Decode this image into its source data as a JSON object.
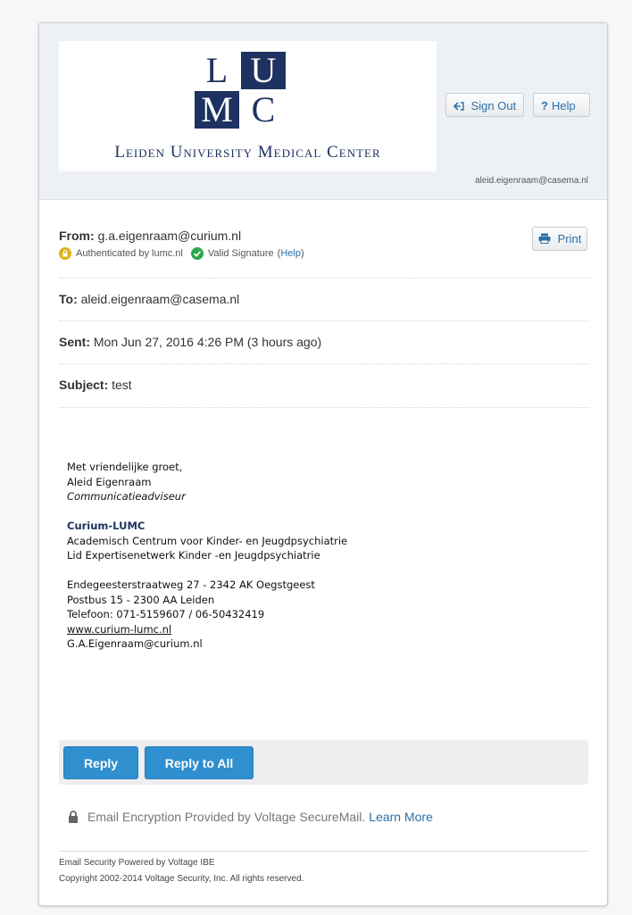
{
  "logo": {
    "cells": [
      "L",
      "U",
      "M",
      "C"
    ],
    "name": "Leiden University Medical Center"
  },
  "header": {
    "sign_out": "Sign Out",
    "help": "Help",
    "user_email": "aleid.eigenraam@casema.nl"
  },
  "message": {
    "from_label": "From:",
    "from_value": "g.a.eigenraam@curium.nl",
    "authenticated": "Authenticated by lumc.nl",
    "valid_signature": "Valid Signature",
    "help_link": "Help",
    "print": "Print",
    "to_label": "To:",
    "to_value": "aleid.eigenraam@casema.nl",
    "sent_label": "Sent:",
    "sent_value": "Mon Jun 27, 2016 4:26 PM (3 hours ago)",
    "subject_label": "Subject:",
    "subject_value": "test"
  },
  "body": {
    "greeting": "Met vriendelijke groet,",
    "name": "Aleid Eigenraam",
    "role": "Communicatieadviseur",
    "org": "Curium-LUMC",
    "org_line1": "Academisch Centrum voor Kinder- en Jeugdpsychiatrie",
    "org_line2": "Lid Expertisenetwerk Kinder -en Jeugdpsychiatrie",
    "address1": "Endegeesterstraatweg 27 - 2342 AK Oegstgeest",
    "address2": "Postbus 15 - 2300 AA Leiden",
    "phone": "Telefoon: 071-5159607 / 06-50432419",
    "website": "www.curium-lumc.nl",
    "email": "G.A.Eigenraam@curium.nl"
  },
  "actions": {
    "reply": "Reply",
    "reply_all": "Reply to All"
  },
  "encryption": {
    "text": "Email Encryption Provided by Voltage SecureMail.",
    "learn_more": "Learn More"
  },
  "footer": {
    "line1": "Email Security Powered by Voltage IBE",
    "line2": "Copyright 2002-2014 Voltage Security, Inc. All rights reserved."
  },
  "colors": {
    "brand_navy": "#1d3260",
    "link_blue": "#2d6fa8",
    "button_blue": "#2f8fcf",
    "auth_gold": "#d9b51a",
    "valid_green": "#2ea84a"
  }
}
